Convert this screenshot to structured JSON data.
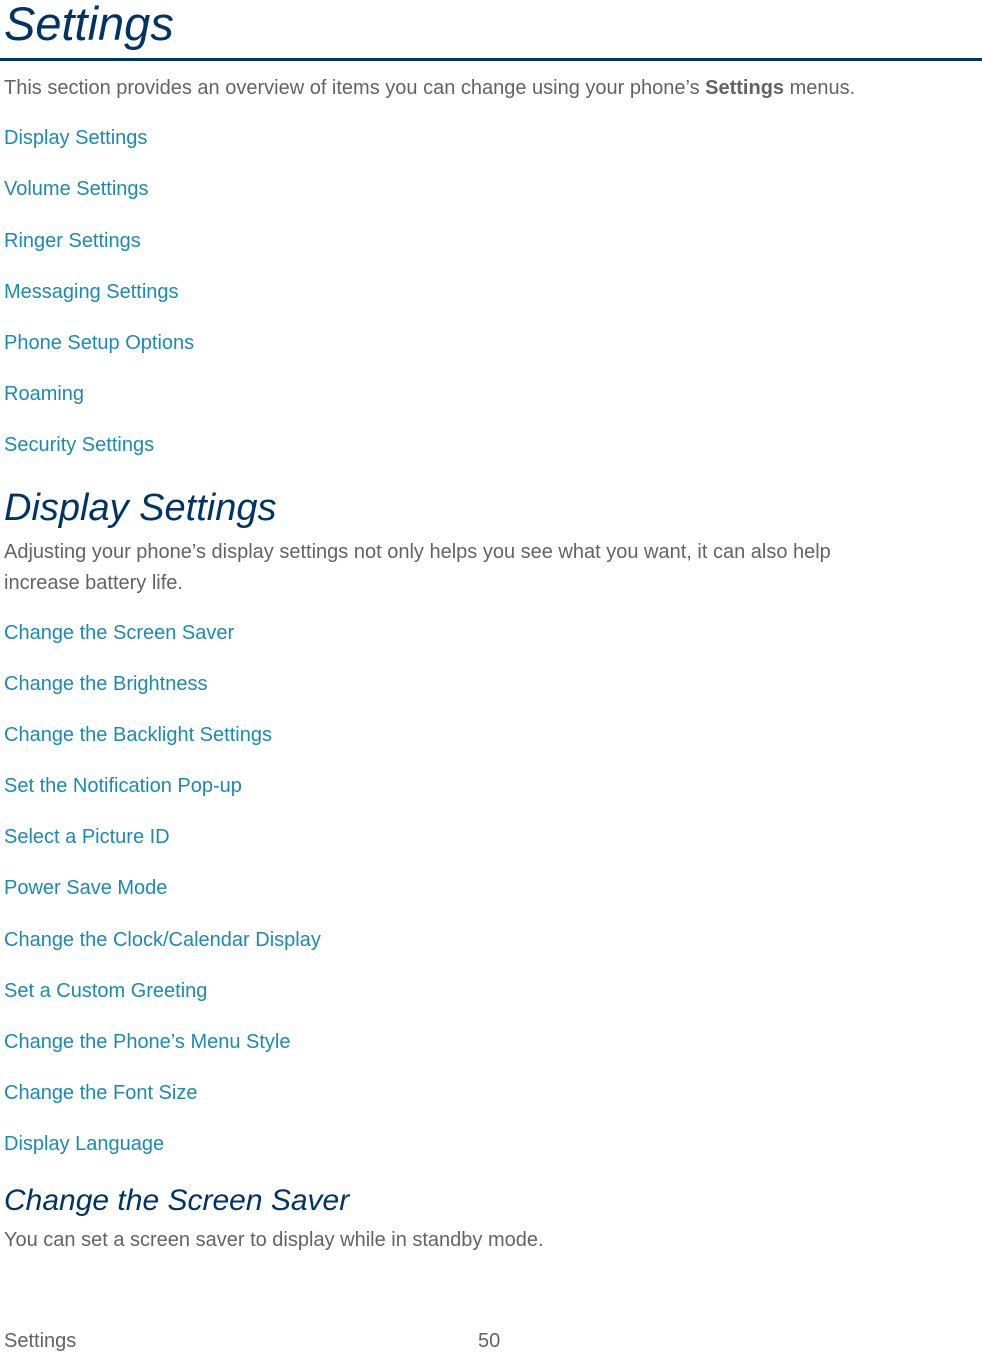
{
  "page": {
    "title": "Settings",
    "intro": {
      "before": "This section provides an overview of items you can change using your phone’s ",
      "bold": "Settings",
      "after": " menus."
    },
    "toc_links": [
      "Display Settings",
      "Volume Settings",
      "Ringer Settings",
      "Messaging Settings",
      "Phone Setup Options",
      "Roaming",
      "Security Settings"
    ],
    "display_section": {
      "heading": "Display Settings",
      "description_line1": "Adjusting your phone’s display settings not only helps you see what you want, it can also help",
      "description_line2": "increase battery life.",
      "links": [
        "Change the Screen Saver",
        "Change the Brightness",
        "Change the Backlight Settings",
        "Set the Notification Pop-up",
        "Select a Picture ID",
        "Power Save Mode",
        "Change the Clock/Calendar Display",
        "Set a Custom Greeting",
        "Change the Phone’s Menu Style",
        "Change the Font Size",
        "Display Language"
      ]
    },
    "screen_saver_section": {
      "heading": "Change the Screen Saver",
      "description": "You can set a screen saver to display while in standby mode."
    },
    "footer": {
      "section_name": "Settings",
      "page_number": "50"
    }
  },
  "colors": {
    "heading": "#003366",
    "link": "#1a8ab5",
    "body_text": "#636363"
  }
}
